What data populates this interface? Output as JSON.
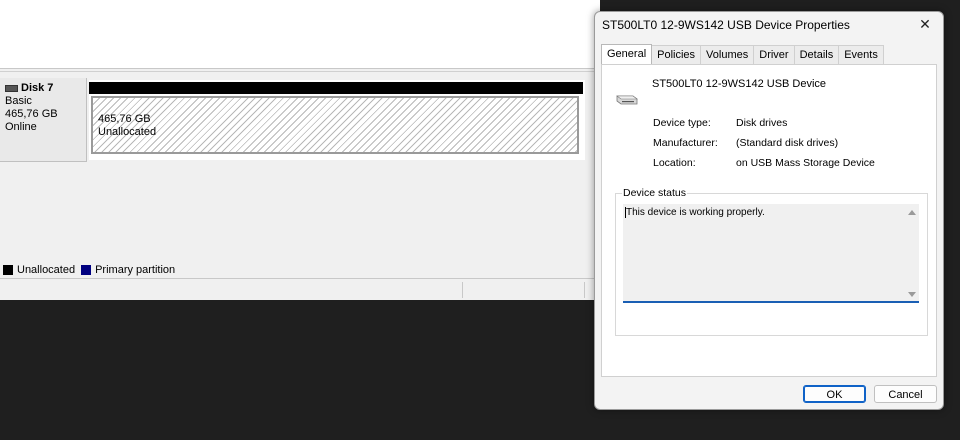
{
  "disk_management": {
    "disk": {
      "name": "Disk 7",
      "type": "Basic",
      "size": "465,76 GB",
      "status": "Online"
    },
    "partition": {
      "size": "465,76 GB",
      "label": "Unallocated"
    },
    "legend": [
      {
        "label": "Unallocated",
        "color": "#000000"
      },
      {
        "label": "Primary partition",
        "color": "#000080"
      }
    ]
  },
  "dialog": {
    "title": "ST500LT0 12-9WS142 USB Device Properties",
    "close_icon": "close-icon",
    "tabs": [
      "General",
      "Policies",
      "Volumes",
      "Driver",
      "Details",
      "Events"
    ],
    "active_tab": "General",
    "device_name": "ST500LT0 12-9WS142 USB Device",
    "properties": [
      {
        "label": "Device type:",
        "value": "Disk drives"
      },
      {
        "label": "Manufacturer:",
        "value": "(Standard disk drives)"
      },
      {
        "label": "Location:",
        "value": "on USB Mass Storage Device"
      }
    ],
    "status_group_title": "Device status",
    "status_text": "This device is working properly.",
    "ok_label": "OK",
    "cancel_label": "Cancel"
  },
  "colors": {
    "accent": "#1a5fb4",
    "taskbar_bg": "#1f1f1f"
  }
}
